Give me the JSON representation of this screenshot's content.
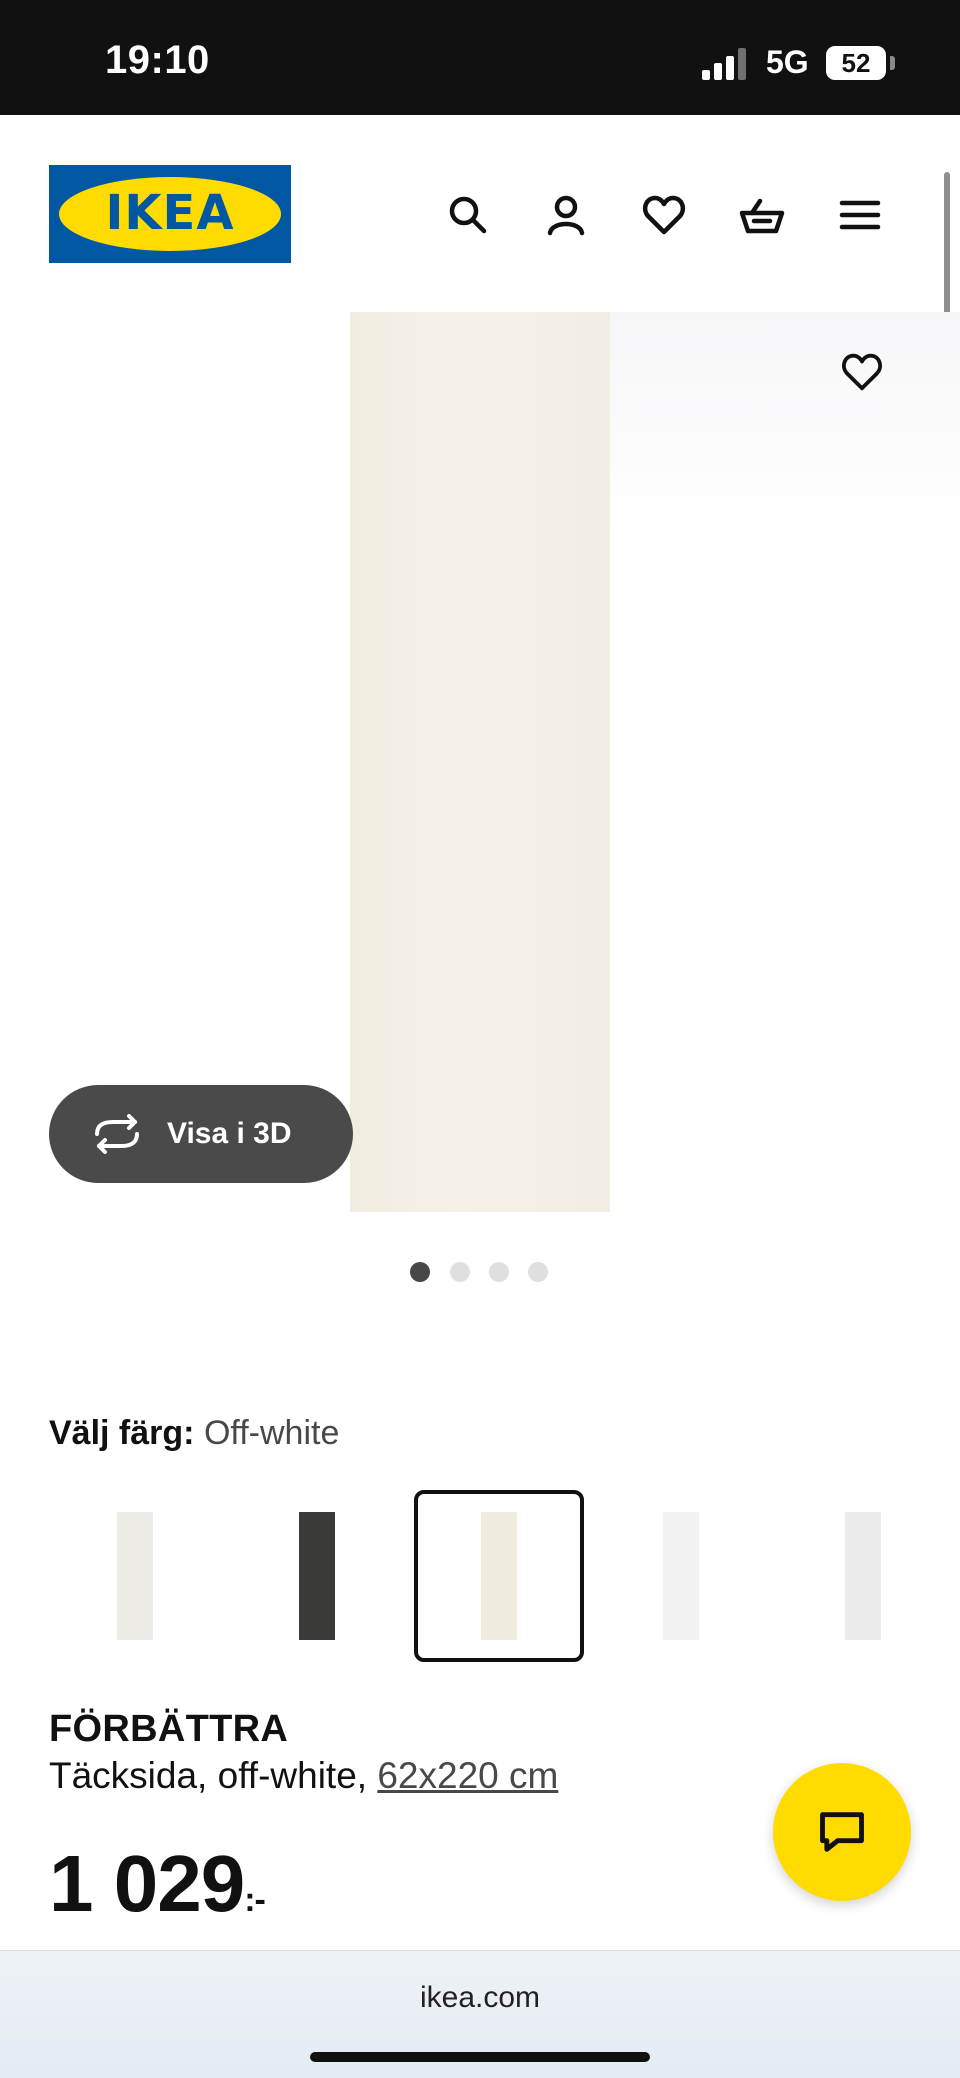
{
  "status_bar": {
    "time": "19:10",
    "network": "5G",
    "battery": "52"
  },
  "header": {
    "logo_text": "IKEA",
    "icons": [
      "search-icon",
      "account-icon",
      "heart-icon",
      "basket-icon",
      "menu-icon"
    ]
  },
  "gallery": {
    "view_3d_label": "Visa i 3D",
    "image_count": 4,
    "active_image": 1
  },
  "color_selector": {
    "label": "Välj färg:",
    "selected": "Off-white",
    "swatches": [
      {
        "name": "white",
        "color": "#ecebe6"
      },
      {
        "name": "black",
        "color": "#3a3a38"
      },
      {
        "name": "off-white",
        "color": "#f0ecdf",
        "selected": true
      },
      {
        "name": "white-high-gloss",
        "color": "#f2f2f3"
      },
      {
        "name": "light-grey",
        "color": "#ebebec"
      }
    ]
  },
  "product": {
    "name": "FÖRBÄTTRA",
    "description": "Täcksida, off-white,",
    "size": "62x220 cm",
    "price": "1 029",
    "price_suffix": ":-"
  },
  "browser": {
    "url": "ikea.com"
  },
  "colors": {
    "ikea_blue": "#0058a3",
    "ikea_yellow": "#ffdb00",
    "pill_bg": "#4a4a4a"
  }
}
